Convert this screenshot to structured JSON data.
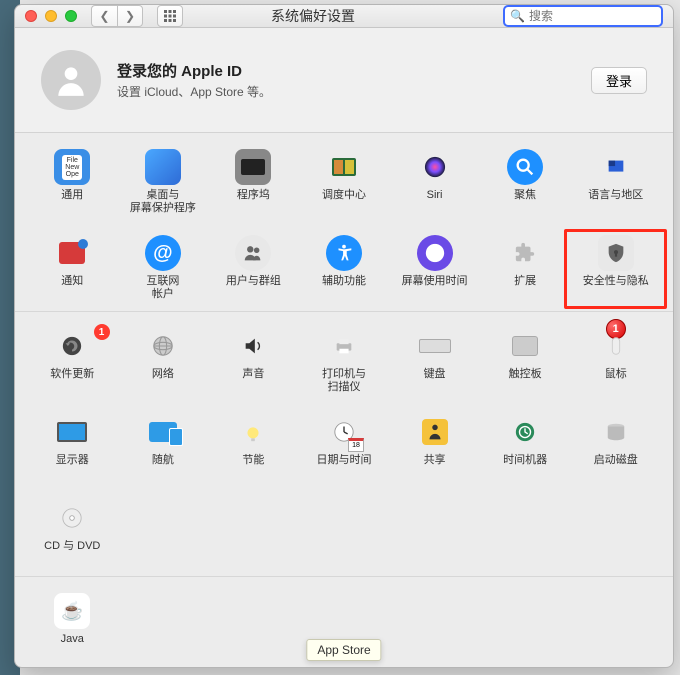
{
  "window": {
    "title": "系统偏好设置",
    "search_placeholder": "搜索"
  },
  "header": {
    "title": "登录您的 Apple ID",
    "subtitle": "设置 iCloud、App Store 等。",
    "login_button": "登录"
  },
  "section1": [
    {
      "name": "general",
      "label": "通用"
    },
    {
      "name": "desktop-screensaver",
      "label": "桌面与\n屏幕保护程序"
    },
    {
      "name": "dock",
      "label": "程序坞"
    },
    {
      "name": "mission-control",
      "label": "调度中心"
    },
    {
      "name": "siri",
      "label": "Siri"
    },
    {
      "name": "spotlight",
      "label": "聚焦"
    },
    {
      "name": "language-region",
      "label": "语言与地区"
    },
    {
      "name": "notifications",
      "label": "通知"
    },
    {
      "name": "internet-accounts",
      "label": "互联网\n帐户"
    },
    {
      "name": "users-groups",
      "label": "用户与群组"
    },
    {
      "name": "accessibility",
      "label": "辅助功能"
    },
    {
      "name": "screen-time",
      "label": "屏幕使用时间"
    },
    {
      "name": "extensions",
      "label": "扩展"
    },
    {
      "name": "security-privacy",
      "label": "安全性与隐私",
      "highlight": true,
      "callout": "1"
    }
  ],
  "section2": [
    {
      "name": "software-update",
      "label": "软件更新",
      "badge": "1"
    },
    {
      "name": "network",
      "label": "网络"
    },
    {
      "name": "sound",
      "label": "声音"
    },
    {
      "name": "printers-scanners",
      "label": "打印机与\n扫描仪"
    },
    {
      "name": "keyboard",
      "label": "键盘"
    },
    {
      "name": "trackpad",
      "label": "触控板"
    },
    {
      "name": "mouse",
      "label": "鼠标"
    },
    {
      "name": "displays",
      "label": "显示器"
    },
    {
      "name": "sidecar",
      "label": "随航"
    },
    {
      "name": "energy-saver",
      "label": "节能"
    },
    {
      "name": "date-time",
      "label": "日期与时间"
    },
    {
      "name": "sharing",
      "label": "共享"
    },
    {
      "name": "time-machine",
      "label": "时间机器"
    },
    {
      "name": "startup-disk",
      "label": "启动磁盘"
    },
    {
      "name": "cds-dvds",
      "label": "CD 与 DVD"
    }
  ],
  "section3": [
    {
      "name": "java",
      "label": "Java"
    }
  ],
  "tooltip": "App Store"
}
